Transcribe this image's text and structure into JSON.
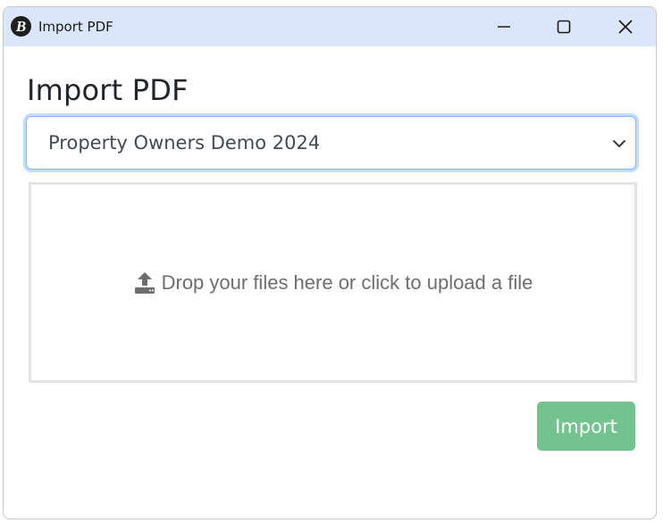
{
  "window": {
    "title": "Import PDF",
    "logo_letter": "B",
    "controls": [
      "minimize-icon",
      "maximize-icon",
      "close-icon"
    ]
  },
  "page": {
    "heading": "Import PDF"
  },
  "project_select": {
    "selected": "Property Owners Demo 2024"
  },
  "dropzone": {
    "icon": "upload-icon",
    "text": "Drop your files here or click to upload a file"
  },
  "actions": {
    "import_label": "Import"
  },
  "colors": {
    "titlebar": "#dbe6fb",
    "import_button": "#74c38f",
    "select_focus_border": "#86b7fe"
  }
}
